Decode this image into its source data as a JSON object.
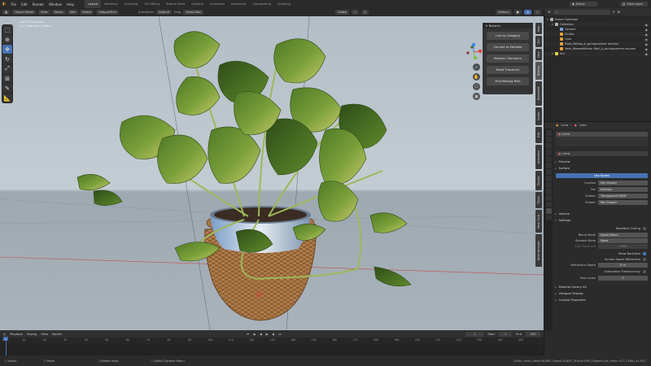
{
  "menu": [
    "File",
    "Edit",
    "Render",
    "Window",
    "Help"
  ],
  "workspaces": [
    {
      "label": "Layout",
      "active": true
    },
    {
      "label": "Modeling",
      "active": false
    },
    {
      "label": "Sculpting",
      "active": false
    },
    {
      "label": "UV Editing",
      "active": false
    },
    {
      "label": "Texture Paint",
      "active": false
    },
    {
      "label": "Shading",
      "active": false
    },
    {
      "label": "Animation",
      "active": false
    },
    {
      "label": "Rendering",
      "active": false
    },
    {
      "label": "Compositing",
      "active": false
    },
    {
      "label": "Scripting",
      "active": false
    }
  ],
  "top": {
    "orientation_label": "Orientation",
    "orientation_value": "Default",
    "drag_label": "Drag",
    "drag_value": "Select Box",
    "pivot": "Global",
    "options": "Options",
    "scene": "Scene",
    "view_layer": "View Layer"
  },
  "viewport_header": {
    "mode": "Object Mode",
    "items": [
      "View",
      "Select",
      "Add",
      "Object"
    ],
    "subdiv": "SubpartFive"
  },
  "viewport_info": {
    "line1": "User Perspective",
    "line2": "(1) Collection | Pothos"
  },
  "npanel": {
    "title": "Botaniq",
    "buttons": [
      "Link by Category",
      "Convert to Editable",
      "Random Transform",
      "Reset Transform",
      "Find Missing Files"
    ],
    "tabs": [
      "Item",
      "Tool",
      "View",
      "Botaniq",
      "BlenderKit",
      "Create",
      "Edit",
      "Animation",
      "Physics",
      "Tissue",
      "Mesh Tools",
      "Node Wrangler"
    ]
  },
  "outliner": {
    "title": "Scene Collection",
    "rows": [
      {
        "label": "Scene Collection",
        "indent": 0,
        "color": "#b0b0b0"
      },
      {
        "label": "Collection",
        "indent": 1,
        "color": "#b0b0b0"
      },
      {
        "label": "Camera",
        "indent": 2,
        "color": "#7fa3d4"
      },
      {
        "label": "Circles",
        "indent": 2,
        "color": "#e8a23a"
      },
      {
        "label": "Lima",
        "indent": 2,
        "color": "#e8a23a"
      },
      {
        "label": "Plant_Pothos_A_springsummer autumn",
        "indent": 2,
        "color": "#e8a23a"
      },
      {
        "label": "Vase_WeavedWicker Wall_A_springsummer autumn",
        "indent": 2,
        "color": "#e8a23a"
      },
      {
        "label": "Sun",
        "indent": 1,
        "color": "#e8d33a"
      }
    ]
  },
  "properties": {
    "breadcrumb_object": "Lima",
    "breadcrumb_material": "Lima",
    "material_slot": "Lima",
    "material_name": "Lima",
    "sections": {
      "preview": "Preview",
      "surface": "Surface",
      "use_nodes": "Use Nodes",
      "volume": "Volume",
      "settings": "Settings",
      "material_library": "Material Library VX",
      "viewport_display": "Viewport Display",
      "custom_properties": "Custom Properties"
    },
    "surface_rows": [
      {
        "label": "Surface",
        "value": "Mix Shader"
      },
      {
        "label": "Fac",
        "value": "Multiply"
      },
      {
        "label": "Shader",
        "value": "Transparent BSDF"
      },
      {
        "label": "Shader",
        "value": "Mix Shader"
      }
    ],
    "settings": {
      "backface_culling": "Backface Culling",
      "blend_mode_label": "Blend Mode",
      "blend_mode": "Alpha Blend",
      "shadow_mode_label": "Shadow Mode",
      "shadow_mode": "None",
      "clip_threshold_label": "Clip Threshold",
      "clip_threshold": "0.500",
      "show_backface": "Show Backface",
      "screen_space_refraction": "Screen Space Refraction",
      "refraction_depth_label": "Refraction Depth",
      "refraction_depth": "0 m",
      "subsurface_translucency": "Subsurface Translucency",
      "pass_index_label": "Pass Index",
      "pass_index": "0"
    }
  },
  "timeline": {
    "menus": [
      "Playback",
      "Keying",
      "View",
      "Marker"
    ],
    "current_frame": "1",
    "start_label": "Start",
    "start": "1",
    "end_label": "End",
    "end": "250",
    "ticks": [
      "0",
      "10",
      "20",
      "30",
      "40",
      "50",
      "60",
      "70",
      "80",
      "90",
      "100",
      "110",
      "120",
      "130",
      "140",
      "150",
      "160",
      "170",
      "180",
      "190",
      "200",
      "210",
      "220",
      "230",
      "240",
      "250"
    ]
  },
  "status": {
    "select": "Select",
    "move": "Move",
    "rotate_view": "Rotate View",
    "object_context": "Object Context Menu",
    "stats": "Circle | Lima | Verts:40,662 | Faces:20,655 | Tris:40,556 | Objects:1/6 | Mem: 417.1 MiB | v2.93.1"
  },
  "colors": {
    "accent": "#4772b3",
    "outliner_object": "#e8a23a",
    "axis_x": "#e0413c",
    "axis_y": "#7fc43a",
    "axis_z": "#3a8ae8"
  }
}
